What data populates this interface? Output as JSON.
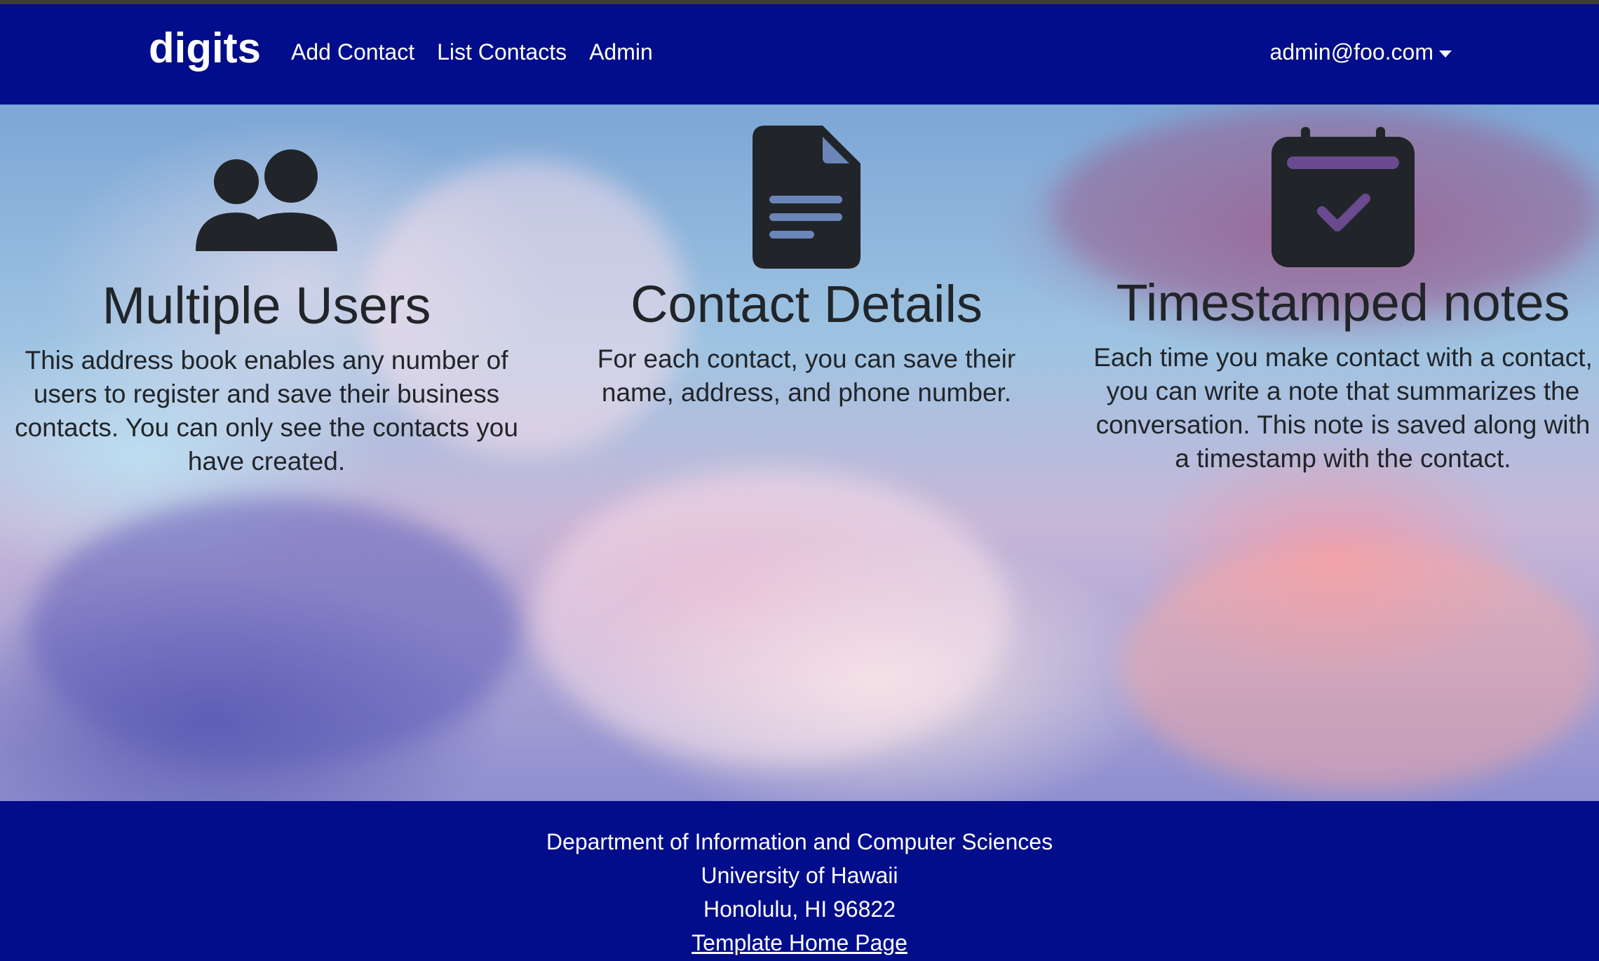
{
  "navbar": {
    "brand": "digits",
    "links": [
      "Add Contact",
      "List Contacts",
      "Admin"
    ],
    "user": "admin@foo.com"
  },
  "features": [
    {
      "icon": "users-icon",
      "title": "Multiple Users",
      "description": "This address book enables any number of users to register and save their business contacts. You can only see the contacts you have created."
    },
    {
      "icon": "document-icon",
      "title": "Contact Details",
      "description": "For each contact, you can save their name, address, and phone number."
    },
    {
      "icon": "calendar-check-icon",
      "title": "Timestamped notes",
      "description": "Each time you make contact with a contact, you can write a note that summarizes the conversation. This note is saved along with a timestamp with the contact."
    }
  ],
  "footer": {
    "lines": [
      "Department of Information and Computer Sciences",
      "University of Hawaii",
      "Honolulu, HI 96822"
    ],
    "link": "Template Home Page"
  },
  "colors": {
    "navbar_bg": "#010d8a",
    "text_dark": "#212529",
    "accent_purple": "#6a4a8f"
  }
}
